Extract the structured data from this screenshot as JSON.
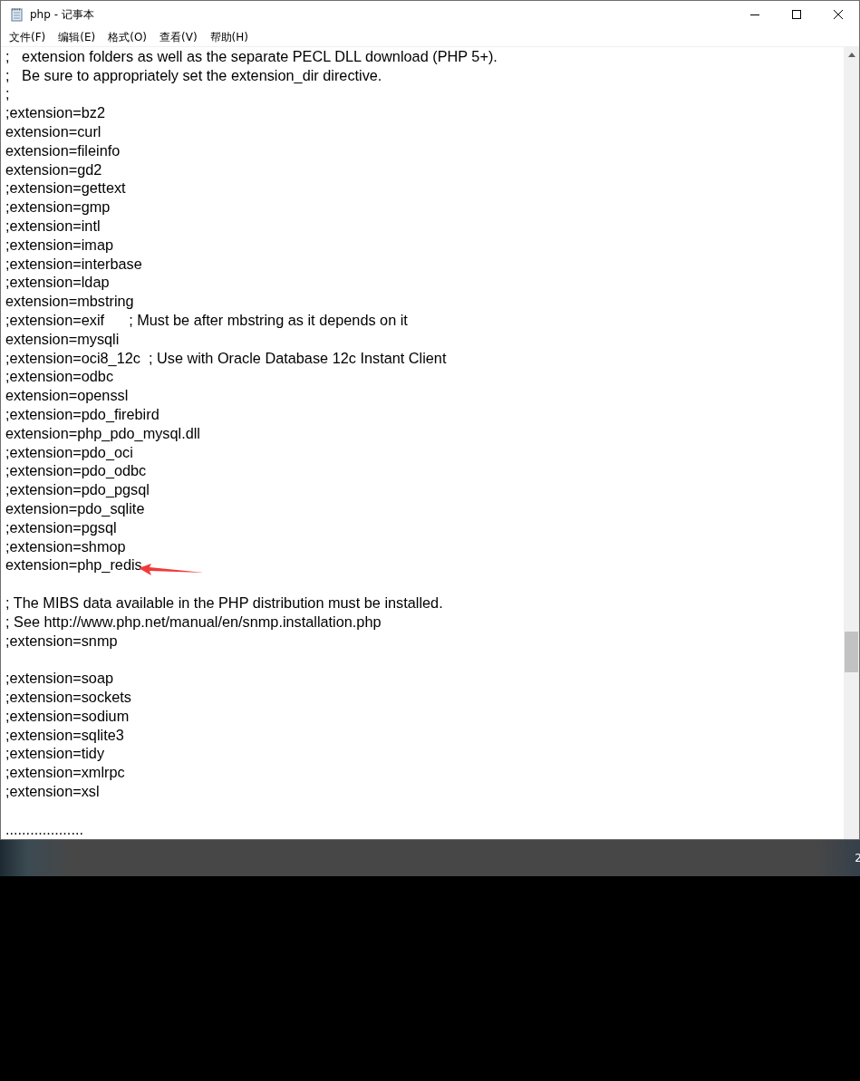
{
  "window": {
    "title": "php - 记事本"
  },
  "menu": [
    "文件(F)",
    "编辑(E)",
    "格式(O)",
    "查看(V)",
    "帮助(H)"
  ],
  "editor": {
    "blocks": [
      [
        {
          "text": ";   extension folders as well as the separate PECL DLL download (PHP 5+).",
          "marked": false
        },
        {
          "text": ";   Be sure to appropriately set the extension_dir directive.",
          "marked": false
        },
        {
          "text": ";",
          "marked": false
        },
        {
          "text": ";extension=bz2",
          "marked": false
        },
        {
          "text": "extension=curl",
          "marked": false
        },
        {
          "text": "extension=fileinfo",
          "marked": false
        },
        {
          "text": "extension=gd2",
          "marked": false
        },
        {
          "text": ";extension=gettext",
          "marked": false
        },
        {
          "text": ";extension=gmp",
          "marked": false
        },
        {
          "text": ";extension=intl",
          "marked": false
        },
        {
          "text": ";extension=imap",
          "marked": false
        },
        {
          "text": ";extension=interbase",
          "marked": false
        },
        {
          "text": ";extension=ldap",
          "marked": false
        },
        {
          "text": "extension=mbstring",
          "marked": false
        },
        {
          "text": ";extension=exif      ; Must be after mbstring as it depends on it",
          "marked": false
        },
        {
          "text": "extension=mysqli",
          "marked": false
        },
        {
          "text": ";extension=oci8_12c  ; Use with Oracle Database 12c Instant Client",
          "marked": false
        },
        {
          "text": ";extension=odbc",
          "marked": false
        },
        {
          "text": "extension=openssl",
          "marked": false
        },
        {
          "text": ";extension=pdo_firebird",
          "marked": false
        },
        {
          "text": "extension=php_pdo_mysql.dll",
          "marked": false
        },
        {
          "text": ";extension=pdo_oci",
          "marked": false
        },
        {
          "text": ";extension=pdo_odbc",
          "marked": false
        },
        {
          "text": ";extension=pdo_pgsql",
          "marked": false
        },
        {
          "text": "extension=pdo_sqlite",
          "marked": false
        },
        {
          "text": ";extension=pgsql",
          "marked": false
        },
        {
          "text": ";extension=shmop",
          "marked": false
        },
        {
          "text": "extension=php_redis",
          "marked": true
        }
      ],
      [
        {
          "text": "; The MIBS data available in the PHP distribution must be installed.",
          "marked": false
        },
        {
          "text": "; See http://www.php.net/manual/en/snmp.installation.php",
          "marked": false
        },
        {
          "text": ";extension=snmp",
          "marked": false
        }
      ],
      [
        {
          "text": ";extension=soap",
          "marked": false
        },
        {
          "text": ";extension=sockets",
          "marked": false
        },
        {
          "text": ";extension=sodium",
          "marked": false
        },
        {
          "text": ";extension=sqlite3",
          "marked": false
        },
        {
          "text": ";extension=tidy",
          "marked": false
        },
        {
          "text": ";extension=xmlrpc",
          "marked": false
        },
        {
          "text": ";extension=xsl",
          "marked": false
        }
      ],
      [
        {
          "text": "...................",
          "marked": false
        }
      ]
    ]
  },
  "taskbar": {
    "clock": "2"
  }
}
